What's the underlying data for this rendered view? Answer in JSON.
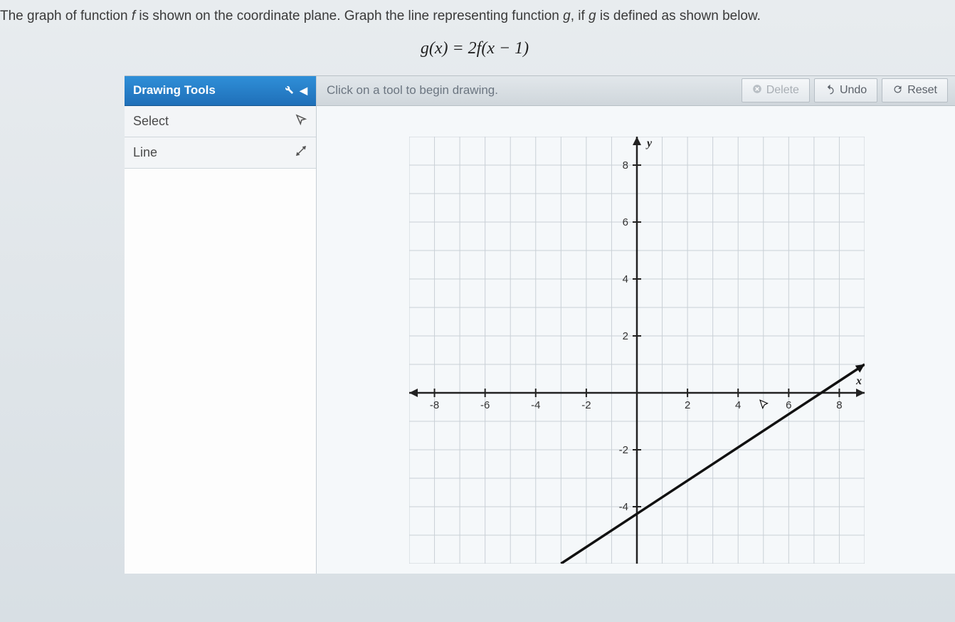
{
  "question": {
    "prompt_prefix": "The graph of function ",
    "f_var": "f",
    "prompt_mid": " is shown on the coordinate plane. Graph the line representing function ",
    "g_var": "g",
    "prompt_mid2": ", if ",
    "g_var2": "g",
    "prompt_suffix": " is defined as shown below.",
    "formula": "g(x) = 2f(x − 1)"
  },
  "tools": {
    "header": "Drawing Tools",
    "items": [
      {
        "label": "Select",
        "icon": "pointer"
      },
      {
        "label": "Line",
        "icon": "line"
      }
    ]
  },
  "toolbar": {
    "hint": "Click on a tool to begin drawing.",
    "delete_label": "Delete",
    "undo_label": "Undo",
    "reset_label": "Reset"
  },
  "chart_data": {
    "type": "line",
    "title": "",
    "xlabel": "x",
    "ylabel": "y",
    "xlim": [
      -9,
      9
    ],
    "ylim": [
      -6,
      9
    ],
    "grid": true,
    "x_ticks": [
      -8,
      -6,
      -4,
      -2,
      2,
      4,
      6,
      8
    ],
    "y_ticks": [
      -4,
      -2,
      2,
      4,
      6,
      8
    ],
    "series": [
      {
        "name": "f",
        "type": "line",
        "points": [
          {
            "x": -3,
            "y": -6
          },
          {
            "x": 9,
            "y": 1
          }
        ],
        "slope": 0.5,
        "y_intercept": -3
      }
    ]
  }
}
